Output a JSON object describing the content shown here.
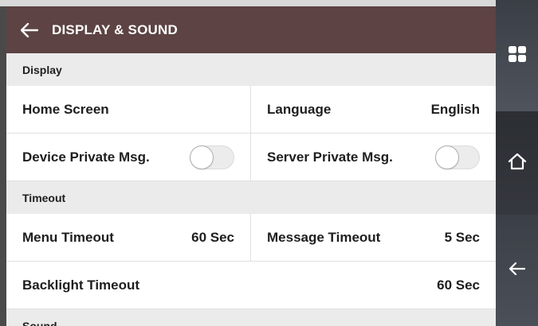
{
  "header": {
    "title": "DISPLAY & SOUND",
    "back_icon": "arrow-left-icon",
    "background": "#5d4343"
  },
  "sections": {
    "display": {
      "title": "Display",
      "home_screen_label": "Home Screen",
      "language_label": "Language",
      "language_value": "English",
      "device_private_msg_label": "Device Private Msg.",
      "device_private_msg_enabled": false,
      "server_private_msg_label": "Server Private Msg.",
      "server_private_msg_enabled": false
    },
    "timeout": {
      "title": "Timeout",
      "menu_timeout_label": "Menu Timeout",
      "menu_timeout_value": "60 Sec",
      "message_timeout_label": "Message Timeout",
      "message_timeout_value": "5 Sec",
      "backlight_timeout_label": "Backlight Timeout",
      "backlight_timeout_value": "60 Sec"
    },
    "sound": {
      "title": "Sound"
    }
  },
  "sidebar": {
    "buttons": [
      {
        "icon": "grid-menu-icon"
      },
      {
        "icon": "home-icon"
      },
      {
        "icon": "arrow-left-icon"
      }
    ]
  },
  "colors": {
    "section_background": "#ebebeb",
    "sidebar": "#3d4148"
  }
}
